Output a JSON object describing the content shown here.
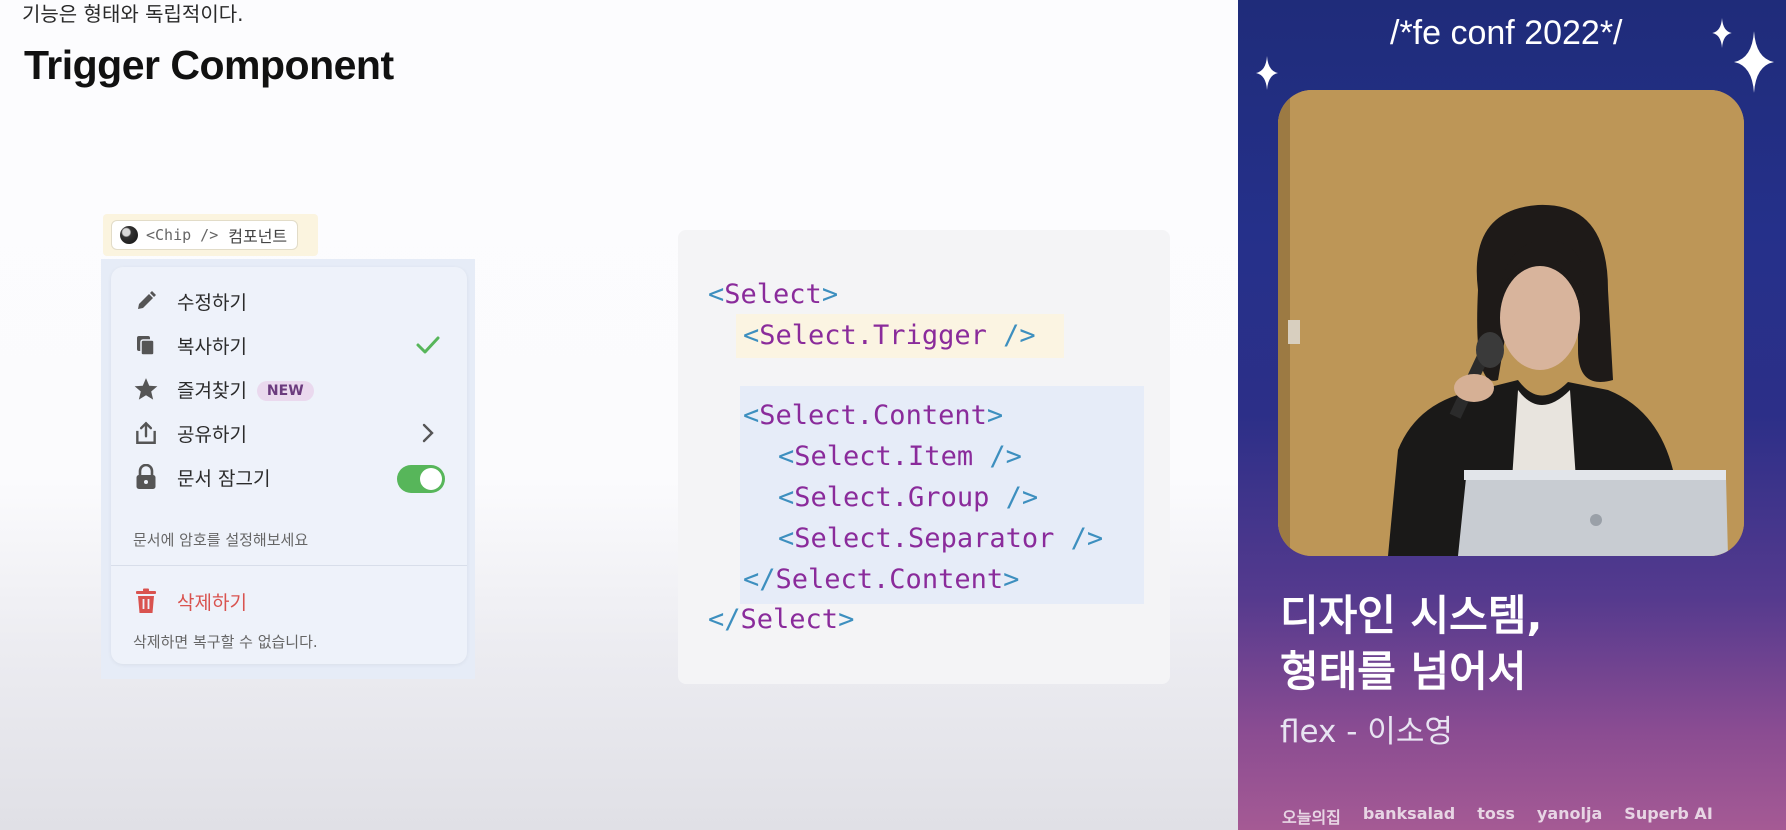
{
  "slide": {
    "subtitle": "기능은 형태와 독립적이다.",
    "title": "Trigger Component",
    "chip": {
      "code": "<Chip />",
      "label": "컴포넌트"
    },
    "menu": {
      "items": [
        {
          "label": "수정하기",
          "icon": "pencil-icon"
        },
        {
          "label": "복사하기",
          "icon": "copy-icon",
          "trailing": "check-icon"
        },
        {
          "label": "즐겨찾기",
          "icon": "star-icon",
          "badge": "NEW"
        },
        {
          "label": "공유하기",
          "icon": "share-icon",
          "trailing": "chevron-right-icon"
        },
        {
          "label": "문서 잠그기",
          "icon": "lock-icon",
          "trailing": "toggle",
          "toggle_on": true,
          "description": "문서에 암호를 설정해보세요"
        },
        {
          "label": "삭제하기",
          "icon": "trash-icon",
          "danger": true,
          "description": "삭제하면 복구할 수 없습니다."
        }
      ]
    },
    "code": {
      "line1": {
        "open": "<",
        "name": "Select",
        "close": ">"
      },
      "line2": {
        "open": "<",
        "name": "Select.Trigger",
        "close": " />"
      },
      "line3": {
        "open": "<",
        "name": "Select.Content",
        "close": ">"
      },
      "line4": {
        "open": "<",
        "name": "Select.Item",
        "close": " />"
      },
      "line5": {
        "open": "<",
        "name": "Select.Group",
        "close": " />"
      },
      "line6": {
        "open": "<",
        "name": "Select.Separator",
        "close": " />"
      },
      "line7": {
        "open": "</",
        "name": "Select.Content",
        "close": ">"
      },
      "line8": {
        "open": "</",
        "name": "Select",
        "close": ">"
      }
    }
  },
  "sidebar": {
    "conf_logo": "/*fe conf 2022*/",
    "talk_title_line1": "디자인 시스템,",
    "talk_title_line2": "형태를 넘어서",
    "speaker": "flex - 이소영",
    "sponsors": [
      "오늘의집",
      "banksalad",
      "toss",
      "yanolja",
      "Superb AI"
    ]
  },
  "colors": {
    "tag_blue": "#3d8fbf",
    "tag_purple": "#8a2b9b",
    "toggle_green": "#57b65a",
    "danger_red": "#d9534f"
  }
}
